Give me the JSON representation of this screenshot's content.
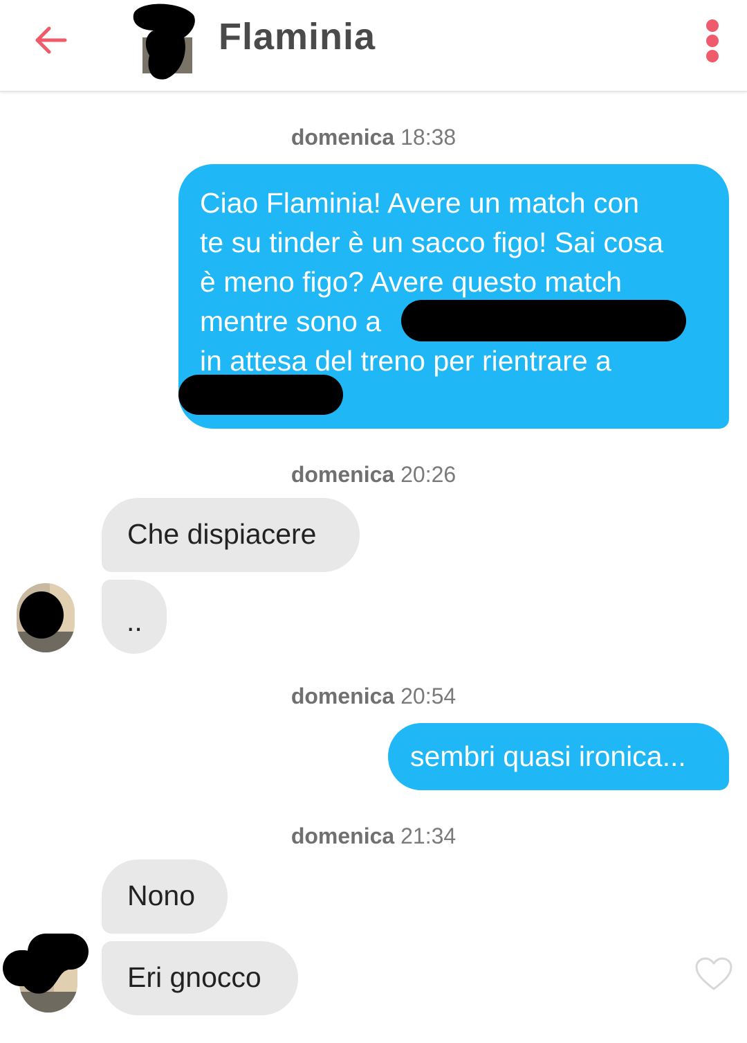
{
  "header": {
    "title": "Flaminia",
    "accent_color": "#ef5b6a",
    "back_icon": "arrow-left-icon",
    "menu_icon": "more-vertical-icon"
  },
  "messages": [
    {
      "timestamp_day": "domenica",
      "timestamp_time": "18:38"
    },
    {
      "sender": "me",
      "lines": [
        "Ciao Flaminia! Avere un match con",
        "te su tinder è un sacco figo! Sai cosa",
        "è meno figo? Avere questo match",
        "mentre sono a",
        "in attesa del treno per rientrare a"
      ]
    },
    {
      "timestamp_day": "domenica",
      "timestamp_time": "20:26"
    },
    {
      "sender": "them",
      "text": "Che dispiacere"
    },
    {
      "sender": "them",
      "text": ".."
    },
    {
      "timestamp_day": "domenica",
      "timestamp_time": "20:54"
    },
    {
      "sender": "me",
      "text": "sembri quasi ironica..."
    },
    {
      "timestamp_day": "domenica",
      "timestamp_time": "21:34"
    },
    {
      "sender": "them",
      "text": "Nono"
    },
    {
      "sender": "them",
      "text": "Eri gnocco"
    }
  ],
  "colors": {
    "sent_bubble": "#1fb7f5",
    "received_bubble": "#e8e8e8",
    "timestamp": "#7a7a7a"
  },
  "like_icon": "heart-outline-icon"
}
